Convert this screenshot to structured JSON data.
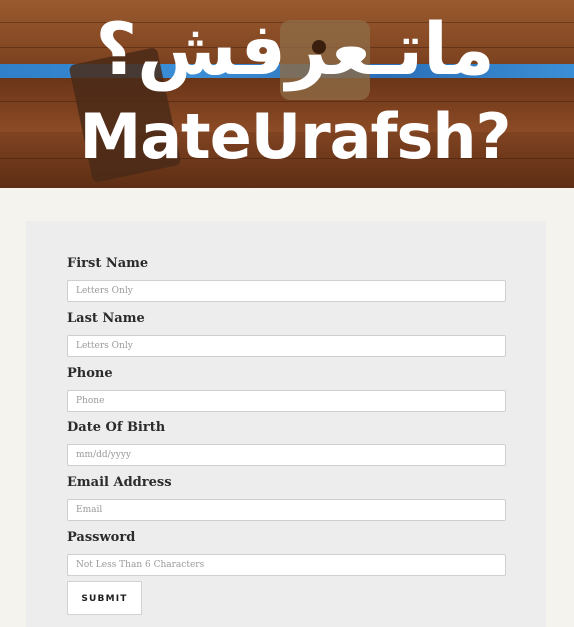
{
  "header": {
    "logo_arabic": "ماتـعرفش؟",
    "logo_english": "MateUrafsh?"
  },
  "form": {
    "fields": [
      {
        "label": "First Name",
        "placeholder": "Letters Only",
        "type": "text"
      },
      {
        "label": "Last Name",
        "placeholder": "Letters Only",
        "type": "text"
      },
      {
        "label": "Phone",
        "placeholder": "Phone",
        "type": "text"
      },
      {
        "label": "Date Of Birth",
        "placeholder": "mm/dd/yyyy",
        "type": "text"
      },
      {
        "label": "Email Address",
        "placeholder": "Email",
        "type": "text"
      },
      {
        "label": "Password",
        "placeholder": "Not Less Than 6 Characters",
        "type": "password"
      }
    ],
    "submit_label": "SUBMIT"
  }
}
